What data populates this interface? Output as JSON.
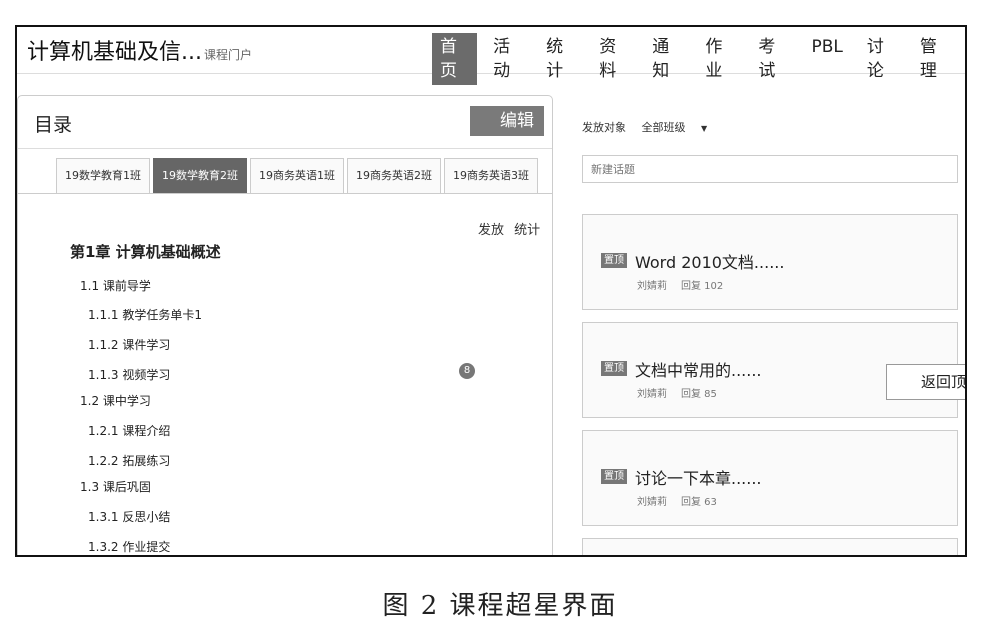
{
  "header": {
    "title": "计算机基础及信...",
    "subtitle": "课程门户",
    "nav": [
      "首页",
      "活动",
      "统计",
      "资料",
      "通知",
      "作业",
      "考试",
      "PBL",
      "讨论",
      "管理"
    ],
    "active_nav": "首页"
  },
  "toc": {
    "title": "目录",
    "edit_label": "编辑",
    "class_tabs": [
      "19数学教育1班",
      "19数学教育2班",
      "19商务英语1班",
      "19商务英语2班",
      "19商务英语3班"
    ],
    "active_tab": "19数学教育2班",
    "tools": [
      "发放",
      "统计"
    ],
    "chapter": "第1章 计算机基础概述",
    "items": [
      "1.1  课前导学",
      "1.1.1 教学任务单卡1",
      "1.1.2 课件学习",
      "1.1.3 视频学习",
      "1.2  课中学习",
      "1.2.1 课程介绍",
      "1.2.2 拓展练习",
      "1.3  课后巩固",
      "1.3.1 反思小结",
      "1.3.2 作业提交"
    ],
    "badge": "8"
  },
  "discussion": {
    "target_label": "发放对象",
    "target_value": "全部班级",
    "dropdown_arrow": "▼",
    "new_topic_placeholder": "新建话题",
    "pin_label": "置顶",
    "topics": [
      {
        "title": "Word 2010文档......",
        "author": "刘婧莉",
        "replies": "回复 102"
      },
      {
        "title": "文档中常用的......",
        "author": "刘婧莉",
        "replies": "回复 85"
      },
      {
        "title": "讨论一下本章......",
        "author": "刘婧莉",
        "replies": "回复 63"
      }
    ],
    "back_to_top": "返回顶部"
  },
  "caption": "图 2   课程超星界面"
}
